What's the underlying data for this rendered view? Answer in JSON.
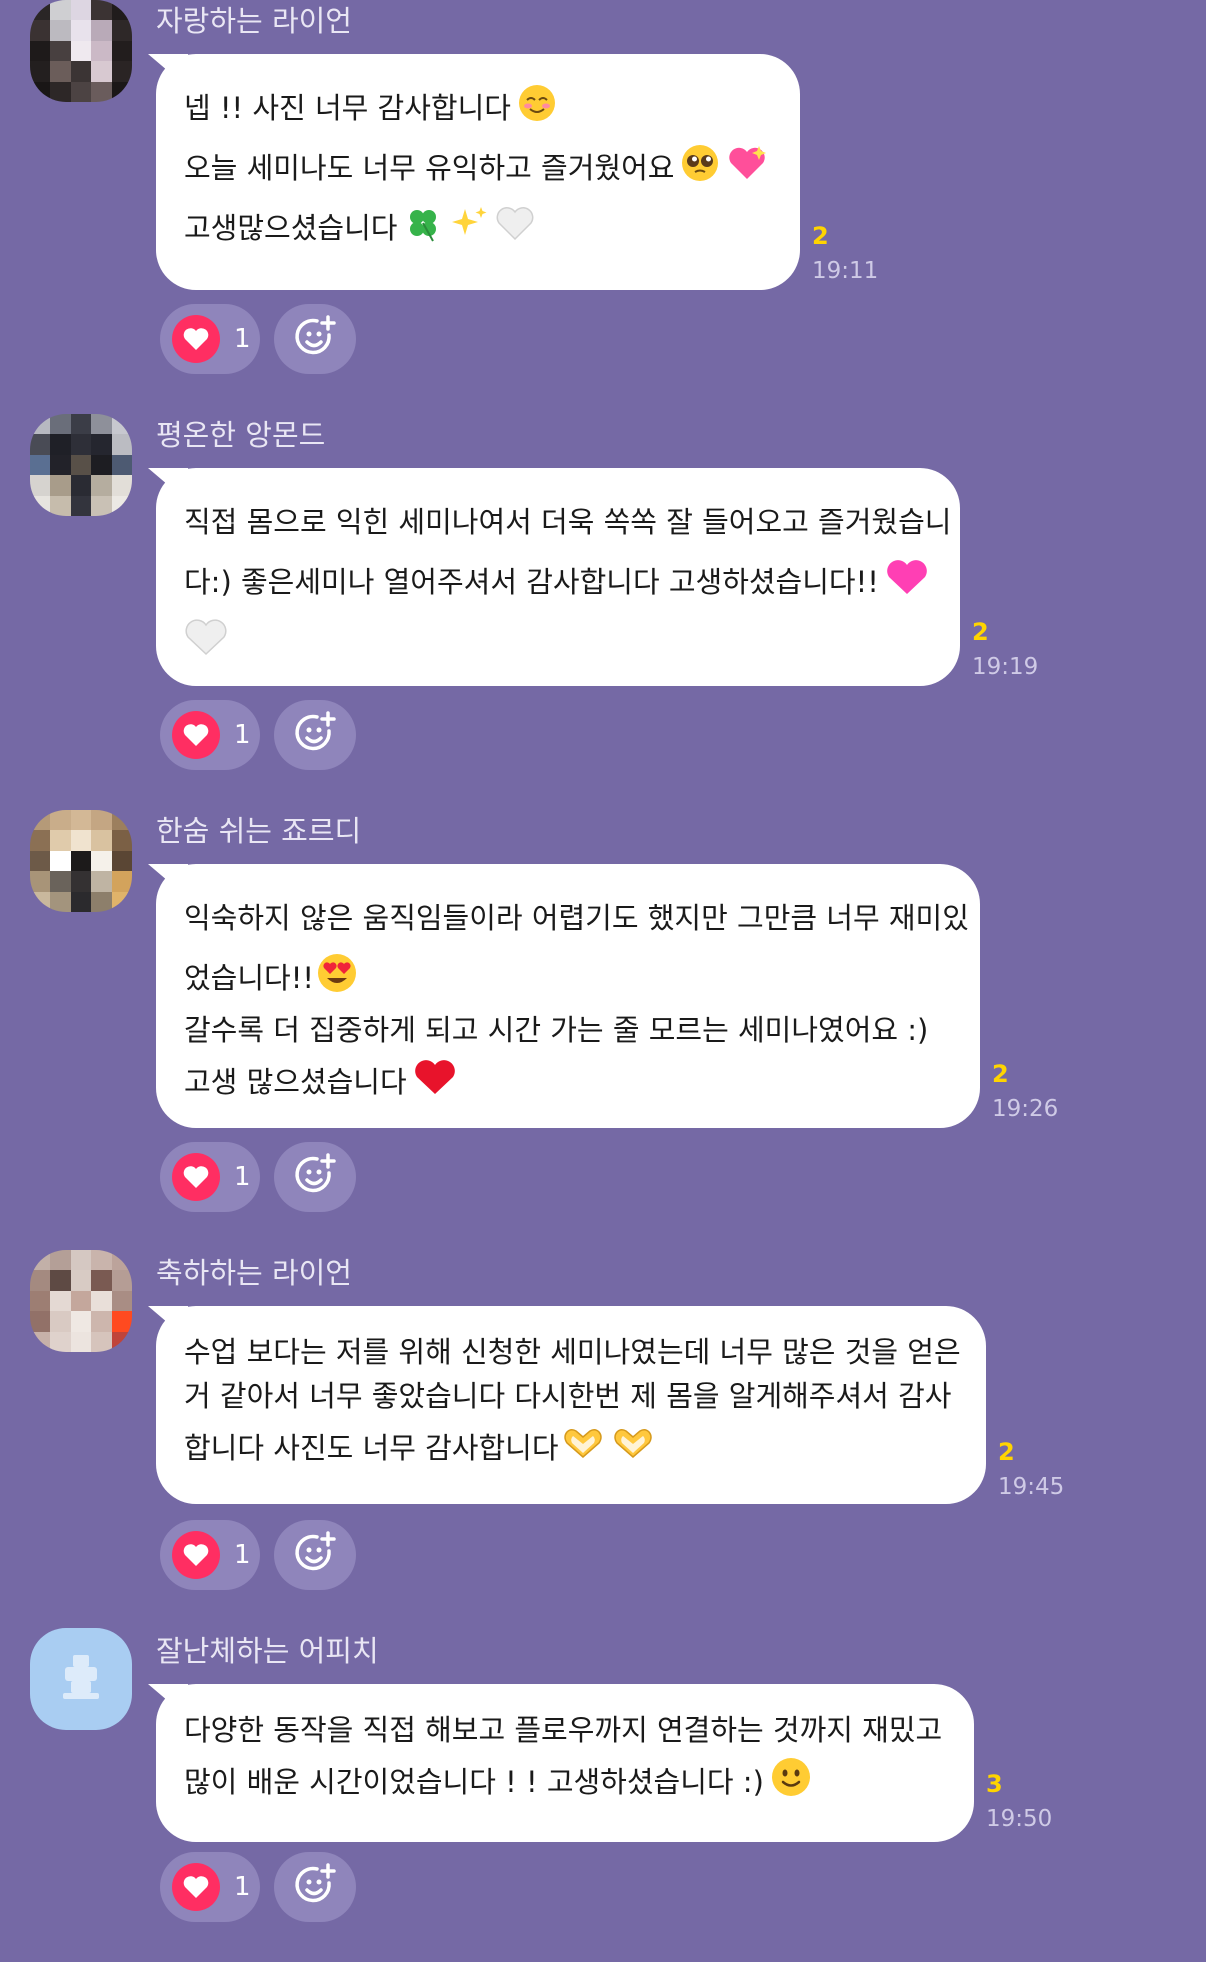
{
  "messages": [
    {
      "sender": "자랑하는 라이언",
      "lines": [
        {
          "text": "넵 !! 사진 너무 감사합니다",
          "emoji": [
            "smiling-blush"
          ]
        },
        {
          "text": "오늘 세미나도 너무 유익하고 즐거웠어요",
          "emoji": [
            "pleading-face",
            "sparkling-heart"
          ]
        },
        {
          "text": "고생많으셨습니다",
          "emoji": [
            "four-leaf-clover",
            "sparkles",
            "white-heart"
          ]
        }
      ],
      "unread": "2",
      "time": "19:11",
      "reaction_count": "1"
    },
    {
      "sender": "평온한 앙몬드",
      "lines": [
        {
          "text": "직접 몸으로 익힌 세미나여서 더욱 쏙쏙 잘 들어오고 즐거웠습니",
          "emoji": []
        },
        {
          "text": "다:) 좋은세미나 열어주셔서 감사합니다 고생하셨습니다!!",
          "emoji": [
            "pink-heart"
          ]
        },
        {
          "text": "",
          "emoji": [
            "white-heart"
          ]
        }
      ],
      "unread": "2",
      "time": "19:19",
      "reaction_count": "1"
    },
    {
      "sender": "한숨 쉬는 죠르디",
      "lines": [
        {
          "text": "익숙하지 않은 움직임들이라 어렵기도 했지만 그만큼 너무 재미있",
          "emoji": []
        },
        {
          "text": "었습니다!!",
          "emoji": [
            "heart-eyes"
          ]
        },
        {
          "text": "갈수록 더 집중하게 되고 시간 가는 줄 모르는 세미나였어요 :)",
          "emoji": []
        },
        {
          "text": "고생 많으셨습니다",
          "emoji": [
            "red-heart"
          ]
        }
      ],
      "unread": "2",
      "time": "19:26",
      "reaction_count": "1"
    },
    {
      "sender": "축하하는 라이언",
      "lines": [
        {
          "text": "수업 보다는 저를 위해 신청한 세미나였는데 너무 많은 것을 얻은",
          "emoji": []
        },
        {
          "text": "거 같아서 너무 좋았습니다 다시한번 제 몸을 알게해주셔서 감사",
          "emoji": []
        },
        {
          "text": "합니다 사진도 너무 감사합니다",
          "emoji": [
            "heart-hands",
            "heart-hands"
          ]
        }
      ],
      "unread": "2",
      "time": "19:45",
      "reaction_count": "1"
    },
    {
      "sender": "잘난체하는 어피치",
      "lines": [
        {
          "text": "다양한 동작을 직접 해보고 플로우까지 연결하는 것까지 재밌고",
          "emoji": []
        },
        {
          "text": "많이 배운 시간이었습니다 ! ! 고생하셨습니다 :)",
          "emoji": [
            "slightly-smiling"
          ]
        }
      ],
      "unread": "3",
      "time": "19:50",
      "reaction_count": "1"
    }
  ],
  "colors": {
    "background": "#7569a5",
    "bubble": "#ffffff",
    "unread": "#ffd400",
    "reaction_heart": "#ff2e62"
  }
}
